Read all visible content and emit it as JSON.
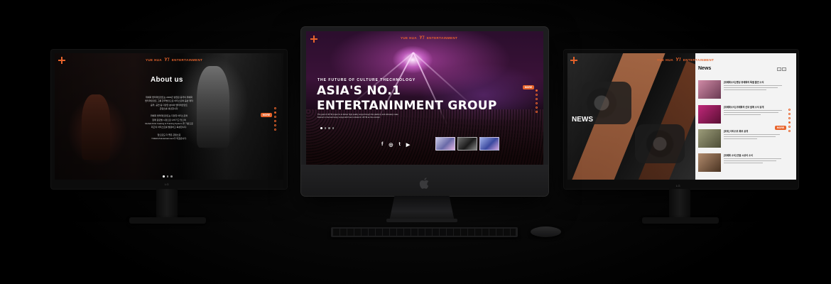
{
  "left_screen": {
    "brand_name": "YUE HUA",
    "brand_logo": "Y!",
    "brand_suffix": "ENTERTAINMENT",
    "title": "About us",
    "button_label": "MORE",
    "body_lines": [
      "위에화 엔터테인먼트는 2009년 설립된 중국의 위에화",
      "엔터테인먼트 그룹 한국법인으로 아티스트와 음반 제작",
      "음악, 공연 등 다양한 분야의 엔터테인먼트",
      "콘텐츠를 생산합니다.",
      "",
      "위에화 엔터테인먼트는 다양한 아티스트와",
      "함께 글로벌 시장으로 나아가고 있으며",
      "Global Artist Casting & Training System 을 기반으로",
      "최고의 아티스트를 발굴하고 육성합니다.",
      "",
      "앞으로도 더 좋은 콘텐츠로",
      "YUEHUA Entertainment가 되겠습니다."
    ],
    "stand_brand": "LG"
  },
  "center_screen": {
    "brand_name": "YUE HUA",
    "brand_logo": "Y!",
    "brand_suffix": "ENTERTAINMENT",
    "subtitle": "THE FUTURE OF CULTURE THECHNOLOGY",
    "title_line1": "ASIA'S NO.1",
    "title_line2": "ENTERTANINMENT GROUP",
    "copy": "The goal of UFYM project is to deliver high quality songs through this platform, and ultimately make listeners to feel and enjoy songs which are included in UFYM as the emotion.",
    "button_label": "MORE",
    "social_icons": [
      "f",
      "◎",
      "t",
      "▶"
    ]
  },
  "right_screen": {
    "brand_name": "YUE HUA",
    "brand_logo": "Y!",
    "brand_suffix": "ENTERTAINMENT",
    "section_label": "NEWS",
    "panel_title": "News",
    "button_label": "MORE",
    "nav_prev": "‹",
    "nav_next": "›",
    "items": [
      {
        "title": "[위에화소식] 펜싱 위에화의 특별 출연 소식"
      },
      {
        "title": "[위에화소식] 위에화의 신보 발매 소식 공개"
      },
      {
        "title": "[포토] 아티스트 화보 공개"
      },
      {
        "title": "[위에화 소식] 연말 시상식 소식"
      }
    ],
    "stand_brand": "LG"
  },
  "colors": {
    "accent": "#e8642c",
    "background": "#000000"
  }
}
